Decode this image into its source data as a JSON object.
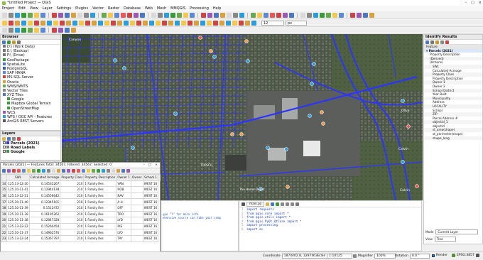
{
  "window": {
    "title": "*Untitled Project — QGIS",
    "controls": [
      "–",
      "□",
      "×"
    ]
  },
  "menu": [
    "Project",
    "Edit",
    "View",
    "Layer",
    "Settings",
    "Plugins",
    "Vector",
    "Raster",
    "Database",
    "Web",
    "Mesh",
    "MMQGIS",
    "Processing",
    "Help"
  ],
  "toolbar": {
    "font_size": "12",
    "unit": "px"
  },
  "browser": {
    "title": "Browser",
    "items": [
      "D:\\ (Work Data)",
      "E:\\ (Backup)",
      "F:\\ (Drive)",
      "GeoPackage",
      "SpatiaLite",
      "PostgreSQL",
      "SAP HANA",
      "MS SQL Server",
      "Oracle",
      "WMS/WMTS",
      "Vector Tiles",
      "XYZ Tiles",
      "Google",
      "Mapbox Global Terrain",
      "OpenStreetMap",
      "WCS",
      "WFS / OGC API - Features",
      "ArcGIS REST Servers"
    ]
  },
  "layers": {
    "title": "Layers",
    "items": [
      "Parcels (2021)",
      "Road Labels",
      "Google"
    ]
  },
  "map": {
    "labels": [
      "Canyon",
      "Olive",
      "Calvin",
      "TOPSCO",
      "The Home Depot",
      "Calvin"
    ]
  },
  "identify": {
    "title": "Identify Results",
    "header": "Feature",
    "layer_name": "Parcels (2021)",
    "fields": [
      "Property Description",
      "(Derived)",
      "(Actions)",
      "SWL",
      "Calculated Acreage",
      "Property Class",
      "Property Description",
      "Owner 1",
      "Owner 2",
      "School District",
      "Year Built",
      "Municipality",
      "Address",
      "LOCALITY",
      "School",
      "ZIP",
      "Parcel Address #",
      "objectid_1",
      "objectid",
      "st_area(shape)",
      "st_perimeter(shape)",
      "shape_leng"
    ],
    "mode_label": "Mode",
    "mode_value": "Current Layer",
    "view_label": "View",
    "view_value": "Tree"
  },
  "attr_table": {
    "title": "Parcels (2021) — Features Total: 34567, Filtered: 34567, Selected: 0",
    "columns": [
      "SWL",
      "Calculated Acreage",
      "Property Class",
      "Property Description",
      "Owner 1",
      "Owner",
      "School 1"
    ],
    "rows": [
      [
        "14",
        "125.13-12-20",
        "0.14532267",
        "210",
        "1 Family Res",
        "VAN",
        "",
        "WEST 16"
      ],
      [
        "15",
        "125.10-11-41",
        "0.12944138",
        "210",
        "1 Family Res",
        "ROB",
        "",
        "WEST 16"
      ],
      [
        "16",
        "125.13-12-21",
        "0.14556642",
        "210",
        "1 Family Res",
        "NAV",
        "",
        "WEST 16"
      ],
      [
        "17",
        "125.10-11-40",
        "0.12345101",
        "210",
        "1 Family Res",
        "A H.",
        "",
        "WEST 16"
      ],
      [
        "18",
        "125.10-11-39",
        "0.1512472",
        "210",
        "1 Family Res",
        "OFF",
        "",
        "WEST 16"
      ],
      [
        "19",
        "125.10-11-39",
        "0.16195262",
        "210",
        "1 Family Res",
        "TRO",
        "",
        "WEST 16"
      ],
      [
        "20",
        "125.10-11-38",
        "0.12847328",
        "210",
        "1 Family Res",
        "LYD",
        "",
        "WEST 16"
      ],
      [
        "21",
        "125.13-12-22",
        "0.15264454",
        "210",
        "1 Family Res",
        "RIE",
        "",
        "WEST 16"
      ],
      [
        "22",
        "125.10-11-37",
        "0.14962576",
        "210",
        "1 Family Res",
        "LYO",
        "",
        "WEST 16"
      ],
      [
        "23",
        "125.13-12-24",
        "0.15367797",
        "210",
        "1 Family Res",
        "TAY",
        "",
        "WEST 16"
      ]
    ]
  },
  "console": {
    "lines": [
      "ype \"?\" for more info",
      "ehensive source can take your comp"
    ]
  },
  "editor": {
    "tab": "main.py",
    "lines": [
      "import requests",
      "from qgis.core import *",
      "from qgis.utils import *",
      "from qgis.PyQt.QtCore import *",
      "import processing",
      "import os"
    ]
  },
  "status": {
    "coordinate_label": "Coordinate",
    "coordinate": "1874402.8, 3297463",
    "scale_label": "Scale",
    "scale": "1:10125",
    "magnifier_label": "Magnifier",
    "magnifier": "100%",
    "rotation_label": "Rotation",
    "rotation": "0.0 °",
    "render_label": "Render",
    "crs": "EPSG:3857"
  },
  "colors": {
    "roads": "#2b35ff",
    "map_dark": "#3d4a38",
    "qgis_green": "#8ac43f"
  }
}
